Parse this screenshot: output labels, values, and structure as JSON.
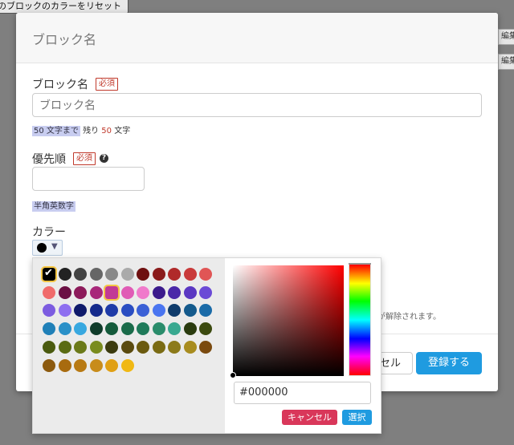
{
  "background": {
    "reset_button_label": "のブロックのカラーをリセット",
    "edit_label": "編集"
  },
  "modal": {
    "title": "ブロック名",
    "name_field": {
      "label": "ブロック名",
      "required_badge": "必須",
      "placeholder": "ブロック名",
      "hint_limit": "50 文字まで",
      "hint_remaining_prefix": "残り",
      "hint_remaining_count": "50",
      "hint_remaining_suffix": "文字"
    },
    "priority_field": {
      "label": "優先順",
      "required_badge": "必須",
      "help_icon_glyph": "?",
      "value": "",
      "hint": "半角英数字"
    },
    "color_field": {
      "label": "カラー",
      "current_color": "#000000",
      "dropdown_glyph": "▼"
    },
    "notice_text": "定が解除されます。",
    "buttons": {
      "cancel": "セル",
      "submit": "登録する"
    }
  },
  "color_picker": {
    "check_glyph": "✔",
    "selected_indices": [
      0,
      15
    ],
    "palette": [
      "#000000",
      "#222222",
      "#444444",
      "#666666",
      "#888888",
      "#aaaaaa",
      "#6e1010",
      "#8a1b1b",
      "#b02a2a",
      "#c93a3a",
      "#e05555",
      "#f06b6b",
      "#6b1044",
      "#8c1a5a",
      "#a8277a",
      "#c23a95",
      "#e05bb6",
      "#f07acb",
      "#3b1a8c",
      "#4a27a8",
      "#5a37c2",
      "#6b4ad6",
      "#7c5ce0",
      "#8e6ff0",
      "#0f1a6b",
      "#152a8c",
      "#1f3ba8",
      "#2a4dc2",
      "#3b60d6",
      "#4a75f0",
      "#0f3b6b",
      "#145a8c",
      "#1a6ba8",
      "#2080b8",
      "#2a90c8",
      "#38a8e0",
      "#0f3b2a",
      "#145a3b",
      "#1a6b4a",
      "#1f7a5a",
      "#2a8c6b",
      "#38a890",
      "#2a3b0f",
      "#3b4a0f",
      "#4a5a0f",
      "#5a6b14",
      "#6b7a1a",
      "#7a8c1f",
      "#3b3b0f",
      "#5a4a0f",
      "#6b5a0f",
      "#7a6b14",
      "#8c7a1a",
      "#a88c1f",
      "#7a4a0f",
      "#8c5a0f",
      "#a86b0f",
      "#b87a14",
      "#c88c1a",
      "#e0a014",
      "#f0b814"
    ],
    "hex_value": "#000000",
    "cancel_label": "キャンセル",
    "select_label": "選択"
  }
}
